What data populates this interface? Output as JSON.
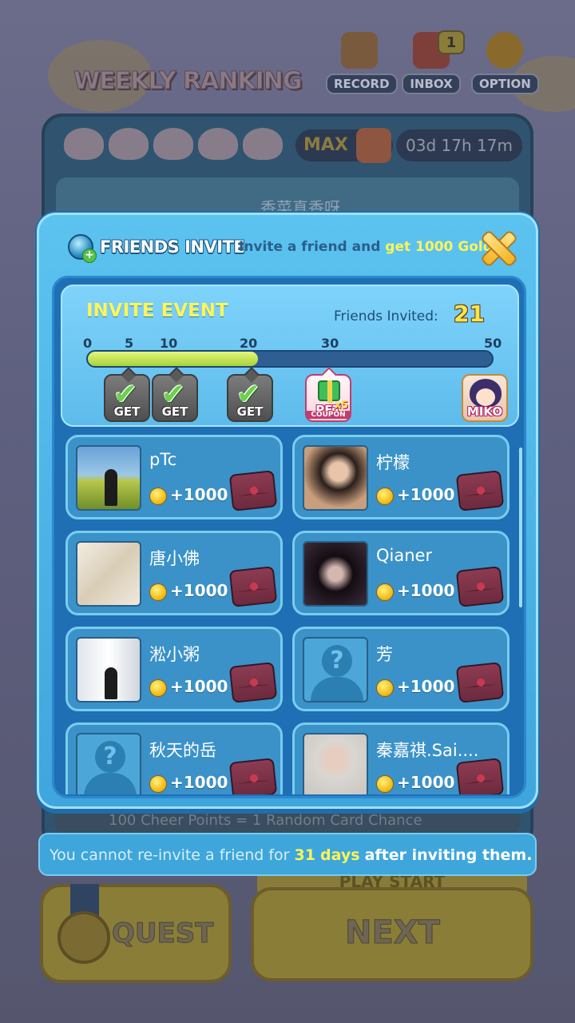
{
  "background": {
    "title": "WEEKLY RANKING",
    "top_buttons": [
      {
        "label": "RECORD",
        "icon": "record-icon"
      },
      {
        "label": "INBOX",
        "icon": "inbox-icon",
        "badge": "1"
      },
      {
        "label": "OPTION",
        "icon": "gear-icon"
      }
    ],
    "hearts_max": "MAX",
    "timer": "03d 17h 17m",
    "ranking_name": "香菜真香呀",
    "cheer_text": "100 Cheer Points = 1 Random Card Chance",
    "play_start": "PLAY START",
    "quest_label": "QUEST",
    "next_label": "NEXT"
  },
  "modal": {
    "title": "FRIENDS INVITE",
    "subtitle_prefix": "Invite a friend and ",
    "subtitle_highlight": "get 1000 Gold!",
    "close_icon": "close-icon"
  },
  "event": {
    "title": "INVITE EVENT",
    "friends_invited_label": "Friends Invited:",
    "friends_invited_value": "21",
    "ticks": [
      "0",
      "5",
      "10",
      "20",
      "30",
      "50"
    ],
    "progress_fraction": 0.42,
    "rewards": [
      {
        "type": "get",
        "label": "GET"
      },
      {
        "type": "get",
        "label": "GET"
      },
      {
        "type": "get",
        "label": "GET"
      },
      {
        "type": "coupon",
        "label": "PET",
        "multiplier": "x5",
        "sub": "COUPON"
      },
      {
        "type": "character",
        "label": "MIKO"
      }
    ]
  },
  "friends": [
    {
      "name": "pTc",
      "reward": "+1000"
    },
    {
      "name": "柠檬",
      "reward": "+1000"
    },
    {
      "name": "唐小佛",
      "reward": "+1000"
    },
    {
      "name": "Qianer",
      "reward": "+1000"
    },
    {
      "name": "淞小粥",
      "reward": "+1000"
    },
    {
      "name": "芳",
      "reward": "+1000"
    },
    {
      "name": "秋天的岳",
      "reward": "+1000"
    },
    {
      "name": "秦嘉祺.Sai....",
      "reward": "+1000"
    }
  ],
  "toast": {
    "prefix": "You cannot re-invite a friend for ",
    "days_number": "31",
    "days_word": "days",
    "suffix": "after inviting them."
  },
  "colors": {
    "modal_bg": "#4fb6e8",
    "inner_bg": "#1f6fb4",
    "highlight_yellow": "#fdf35a",
    "progress_green": "#a8d23a"
  }
}
